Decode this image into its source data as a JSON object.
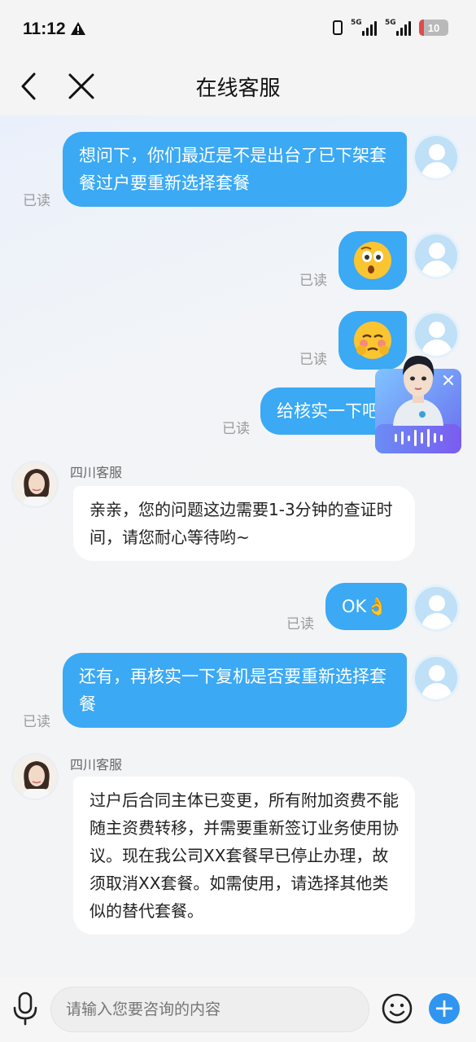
{
  "status_bar": {
    "time": "11:12",
    "signal1_label": "5G",
    "signal2_label": "5G",
    "battery": "10"
  },
  "nav": {
    "title": "在线客服"
  },
  "messages": [
    {
      "id": "m1",
      "type": "user",
      "read": "已读",
      "text": "想问下，你们最近是不是出台了已下架套餐过户要重新选择套餐"
    },
    {
      "id": "m2",
      "type": "user-emoji",
      "read": "已读",
      "emoji": "surprised-emoji"
    },
    {
      "id": "m3",
      "type": "user-emoji",
      "read": "已读",
      "emoji": "pleading-emoji"
    },
    {
      "id": "m4",
      "type": "user",
      "read": "已读",
      "text": "给核实一下吧"
    },
    {
      "id": "m5",
      "type": "bot",
      "name": "四川客服",
      "text": "亲亲，您的问题这边需要1-3分钟的查证时间，请您耐心等待哟~"
    },
    {
      "id": "m6",
      "type": "user",
      "read": "已读",
      "text": "OK👌"
    },
    {
      "id": "m7",
      "type": "user",
      "read": "已读",
      "text": "还有，再核实一下复机是否要重新选择套餐"
    },
    {
      "id": "m8",
      "type": "bot",
      "name": "四川客服",
      "text": "过户后合同主体已变更，所有附加资费不能随主资费转移，并需要重新签订业务使用协议。现在我公司XX套餐早已停止办理，故须取消XX套餐。如需使用，请选择其他类似的替代套餐。"
    }
  ],
  "float_agent": {
    "icon": "voice-assistant-avatar"
  },
  "input_bar": {
    "placeholder": "请输入您要咨询的内容"
  },
  "colors": {
    "user_bubble": "#3ba9f4",
    "bot_bubble": "#ffffff",
    "accent": "#2f95f0"
  }
}
